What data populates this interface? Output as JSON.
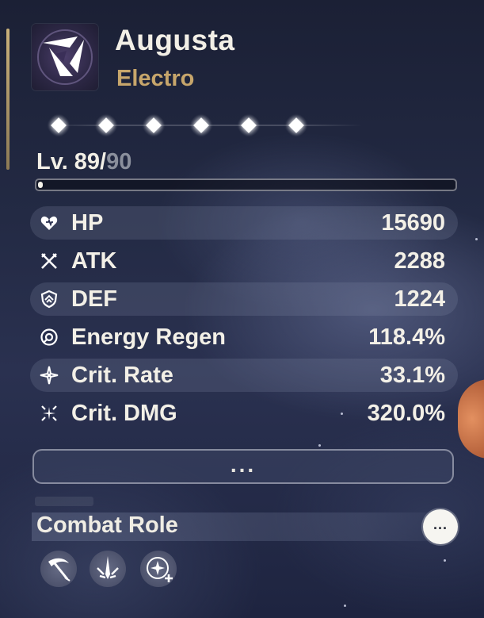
{
  "character": {
    "name": "Augusta",
    "element": "Electro",
    "element_icon": "electro-element-icon",
    "accent_color": "#c7a66b"
  },
  "constellations": {
    "unlocked": 6,
    "total": 6
  },
  "level": {
    "current": "Lv. 89/",
    "max": "90",
    "progress_fraction": 0.01
  },
  "stats": [
    {
      "icon": "hp-heart-icon",
      "label": "HP",
      "value": "15690"
    },
    {
      "icon": "atk-swords-icon",
      "label": "ATK",
      "value": "2288"
    },
    {
      "icon": "def-shield-icon",
      "label": "DEF",
      "value": "1224"
    },
    {
      "icon": "energy-regen-icon",
      "label": "Energy Regen",
      "value": "118.4%"
    },
    {
      "icon": "crit-rate-icon",
      "label": "Crit. Rate",
      "value": "33.1%"
    },
    {
      "icon": "crit-dmg-icon",
      "label": "Crit. DMG",
      "value": "320.0%"
    }
  ],
  "more_button": {
    "label": "..."
  },
  "combat_role": {
    "title": "Combat Role",
    "info_label": "...",
    "roles": [
      "scythe-role-icon",
      "sword-burst-role-icon",
      "star-plus-role-icon"
    ]
  }
}
